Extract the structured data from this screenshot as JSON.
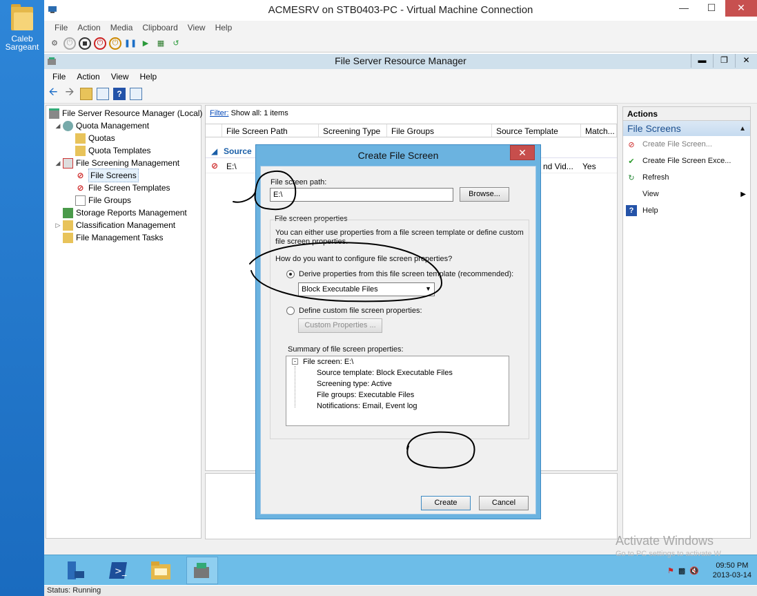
{
  "desktop": {
    "icon_label": "Caleb Sargeant"
  },
  "vm": {
    "title": "ACMESRV on STB0403-PC - Virtual Machine Connection",
    "menu": [
      "File",
      "Action",
      "Media",
      "Clipboard",
      "View",
      "Help"
    ]
  },
  "fsrm": {
    "title": "File Server Resource Manager",
    "menu": [
      "File",
      "Action",
      "View",
      "Help"
    ],
    "tree": [
      {
        "label": "File Server Resource Manager (Local)",
        "icon": "fsrm-icon"
      },
      {
        "label": "Quota Management",
        "icon": "quota-icon"
      },
      {
        "label": "Quotas",
        "icon": "folder-icon"
      },
      {
        "label": "Quota Templates",
        "icon": "folder-icon"
      },
      {
        "label": "File Screening Management",
        "icon": "screening-icon"
      },
      {
        "label": "File Screens",
        "icon": "file-screen-icon"
      },
      {
        "label": "File Screen Templates",
        "icon": "template-icon"
      },
      {
        "label": "File Groups",
        "icon": "file-icon"
      },
      {
        "label": "Storage Reports Management",
        "icon": "reports-icon"
      },
      {
        "label": "Classification Management",
        "icon": "classification-icon"
      },
      {
        "label": "File Management Tasks",
        "icon": "tasks-icon"
      }
    ],
    "filter_link": "Filter:",
    "filter_text": "Show all: 1 items",
    "columns": [
      "File Screen Path",
      "Screening Type",
      "File Groups",
      "Source Template",
      "Match..."
    ],
    "group_label": "Source",
    "row": {
      "path": "E:\\",
      "source_partial": "nd Vid...",
      "match": "Yes"
    },
    "actions": {
      "header": "Actions",
      "section": "File Screens",
      "items": [
        {
          "label": "Create File Screen...",
          "disabled": true
        },
        {
          "label": "Create File Screen Exce..."
        },
        {
          "label": "Refresh"
        },
        {
          "label": "View"
        },
        {
          "label": "Help"
        }
      ]
    }
  },
  "dialog": {
    "title": "Create File Screen",
    "path_label": "File screen path:",
    "path_value": "E:\\",
    "browse_label": "Browse...",
    "props_group": "File screen properties",
    "props_desc": "You can either use properties from a file screen template or define custom file screen properties.",
    "question": "How do you want to configure file screen properties?",
    "option_derive": "Derive properties from this file screen template (recommended):",
    "template_value": "Block Executable Files",
    "option_custom": "Define custom file screen properties:",
    "custom_button": "Custom Properties ...",
    "summary_label": "Summary of file screen properties:",
    "summary": {
      "root": "File screen: E:\\",
      "lines": [
        "Source template: Block Executable Files",
        "Screening type: Active",
        "File groups: Executable Files",
        "Notifications: Email, Event log"
      ]
    },
    "create_label": "Create",
    "cancel_label": "Cancel"
  },
  "taskbar": {
    "time": "09:50 PM",
    "date": "2013-03-14"
  },
  "status": "Status: Running",
  "watermark": {
    "line1": "Activate Windows",
    "line2": "Go to PC settings to activate W"
  }
}
